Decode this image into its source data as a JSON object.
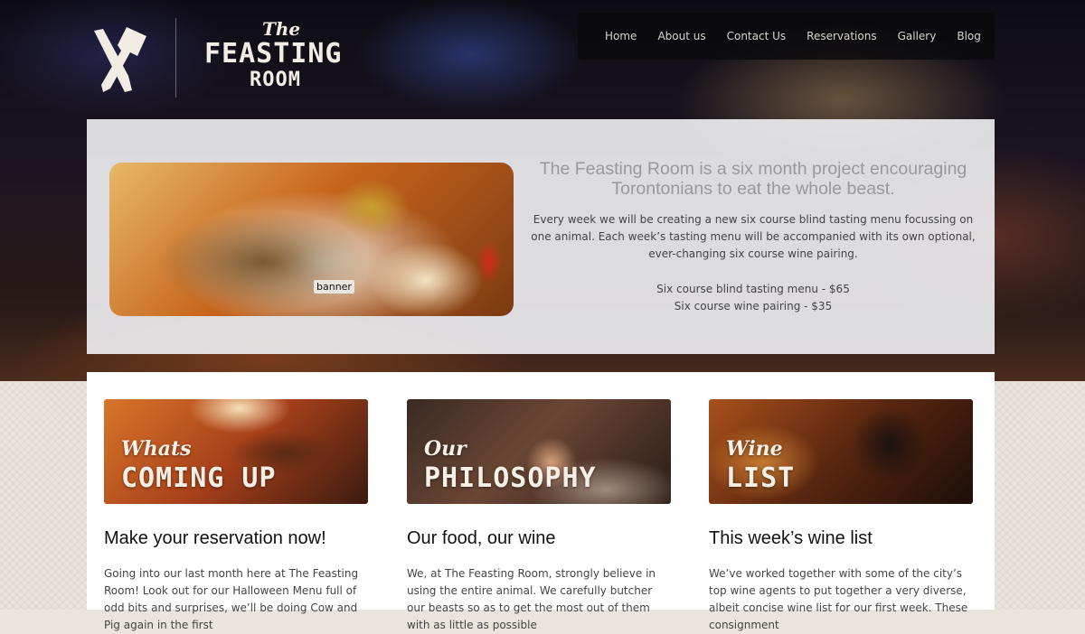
{
  "logo": {
    "line1": "The",
    "line2": "FEASTING",
    "line3": "ROOM"
  },
  "nav": {
    "items": [
      "Home",
      "About us",
      "Contact Us",
      "Reservations",
      "Gallery",
      "Blog"
    ]
  },
  "banner": {
    "image_tag": "banner",
    "headline": "The Feasting Room is a six month project encouraging Torontonians to eat the whole beast.",
    "description": "Every week we will be creating a new six course blind tasting menu focussing on one animal. Each week’s tasting menu will be accompanied with its own optional, ever-changing six course wine pairing.",
    "price_tasting": "Six course blind tasting menu - $65",
    "price_wine": "Six course wine pairing - $35"
  },
  "cards": [
    {
      "img_script": "Whats",
      "img_big": "COMING UP",
      "title": "Make your reservation now!",
      "text": "Going into our last month here at The Feasting Room! Look out for our Halloween Menu full of odd bits and surprises, we’ll be doing Cow and Pig again in the first"
    },
    {
      "img_script": "Our",
      "img_big": "PHILOSOPHY",
      "title": "Our food, our wine",
      "text": "We, at The Feasting Room, strongly believe in using the entire animal. We carefully butcher our beasts so as to get the most out of them with as little as possible"
    },
    {
      "img_script": "Wine",
      "img_big": "LIST",
      "title": "This week’s wine list",
      "text": "We’ve worked together with some of the city’s top wine agents to put together a very diverse, albeit concise wine list for our first week. These consignment"
    }
  ]
}
